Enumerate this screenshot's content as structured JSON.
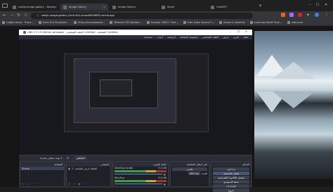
{
  "tabs": [
    {
      "label": "nextjs-image-gallery · Deployment"
    },
    {
      "label": "Image Gallery"
    },
    {
      "label": "Image Gallery"
    },
    {
      "label": "Sonet"
    },
    {
      "label": "ChatGPT"
    }
  ],
  "address": {
    "url": "nextjs-image-gallery-y3c4u52z-snow46926692.vercel.app"
  },
  "bookmarks": [
    {
      "label": "rubber band - Trans..."
    },
    {
      "label": "Front End Engineer..."
    },
    {
      "label": "https://sunaaaaaaa..."
    },
    {
      "label": "Tailwind CSS Navbar..."
    },
    {
      "label": "Explore 3000+ Free..."
    },
    {
      "label": "Free Open Source T..."
    },
    {
      "label": "Adnan's material"
    },
    {
      "label": "Learning Wordi Shan..."
    },
    {
      "label": "welcome"
    }
  ],
  "obs": {
    "title": "OBS 27.1.3 (64 bit, windows) - الملف الشخصي: Untitled - المشاهد: Untitled",
    "menu": [
      "مساعدة",
      "أدوات",
      "الرصيف",
      "مجموعة المشاهد",
      "الملف الشخصي",
      "عرض",
      "تحرير",
      "ملف"
    ],
    "status_text": "لا توجد مصادر محددة",
    "status_button": "خصائص",
    "panels": {
      "scenes": {
        "title": "المشاهد",
        "item": "Scene"
      },
      "sources": {
        "title": "المصادر",
        "item": "التقاط عرض الشاشة"
      },
      "mixer": {
        "title": "خلاط الصوت",
        "tracks": [
          "Desktop Audio",
          "Mic/Aux"
        ],
        "db": [
          "0.0 dB",
          "0.0 dB"
        ]
      },
      "transitions": {
        "title": "تأثير انتقال المشاهد",
        "mode": "تلاشي",
        "duration_label": "المدة",
        "duration": "300 ms"
      },
      "controls": {
        "title": "التحكم",
        "buttons": [
          "بدء البث",
          "إيقاف التسجيل",
          "تشغيل الكاميرا الافتراضية",
          "نمط الاستوديو",
          "الإعدادات",
          "خروج"
        ]
      }
    }
  }
}
